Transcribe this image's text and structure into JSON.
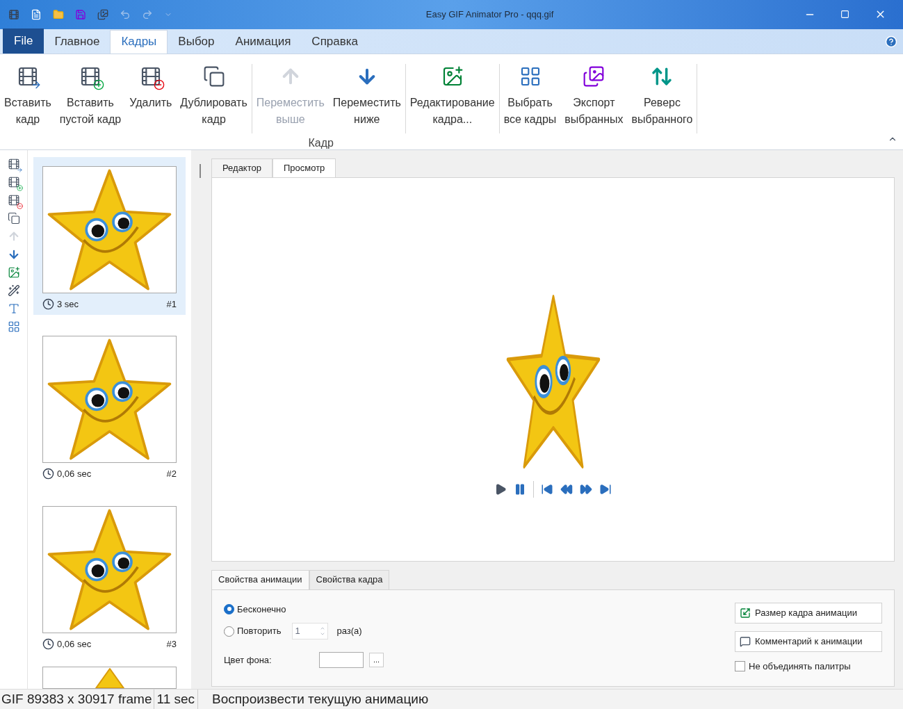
{
  "window": {
    "title": "Easy GIF Animator Pro - qqq.gif"
  },
  "quick_access": [
    {
      "kind": "film",
      "disabled": false
    },
    {
      "kind": "new",
      "disabled": false
    },
    {
      "kind": "open",
      "disabled": false
    },
    {
      "kind": "save",
      "disabled": false
    },
    {
      "kind": "export",
      "disabled": false
    },
    {
      "kind": "undo",
      "disabled": true
    },
    {
      "kind": "redo",
      "disabled": true
    },
    {
      "kind": "more",
      "disabled": true
    }
  ],
  "menu_tabs": [
    {
      "label": "File",
      "kind": "file",
      "selected": false
    },
    {
      "label": "Главное",
      "kind": "tab",
      "selected": false
    },
    {
      "label": "Кадры",
      "kind": "tab",
      "selected": true
    },
    {
      "label": "Выбор",
      "kind": "tab",
      "selected": false
    },
    {
      "label": "Анимация",
      "kind": "tab",
      "selected": false
    },
    {
      "label": "Справка",
      "kind": "tab",
      "selected": false
    }
  ],
  "ribbon": {
    "group_label": "Кадр",
    "sections": [
      [
        {
          "kind": "insert",
          "lines": [
            "Вставить",
            "кадр"
          ],
          "disabled": false
        },
        {
          "kind": "insert_blank",
          "lines": [
            "Вставить",
            "пустой кадр"
          ],
          "disabled": false
        },
        {
          "kind": "delete",
          "lines": [
            "Удалить"
          ],
          "disabled": false
        },
        {
          "kind": "duplicate",
          "lines": [
            "Дублировать",
            "кадр"
          ],
          "disabled": false
        }
      ],
      [
        {
          "kind": "up",
          "lines": [
            "Переместить",
            "выше"
          ],
          "disabled": true
        },
        {
          "kind": "down",
          "lines": [
            "Переместить",
            "ниже"
          ],
          "disabled": false
        }
      ],
      [
        {
          "kind": "edit",
          "lines": [
            "Редактирование",
            "кадра..."
          ],
          "disabled": false
        }
      ],
      [
        {
          "kind": "select_all",
          "lines": [
            "Выбрать",
            "все кадры"
          ],
          "disabled": false
        },
        {
          "kind": "export",
          "lines": [
            "Экспорт",
            "выбранных"
          ],
          "disabled": false
        },
        {
          "kind": "reverse",
          "lines": [
            "Реверс",
            "выбранного"
          ],
          "disabled": false
        }
      ]
    ]
  },
  "side_toolbar": [
    {
      "kind": "insert",
      "disabled": false
    },
    {
      "kind": "insert_blank",
      "disabled": false
    },
    {
      "kind": "delete",
      "disabled": false
    },
    {
      "kind": "duplicate",
      "disabled": false
    },
    {
      "kind": "up",
      "disabled": true
    },
    {
      "kind": "down",
      "disabled": false
    },
    {
      "kind": "edit",
      "disabled": false
    },
    {
      "kind": "wand",
      "disabled": false
    },
    {
      "kind": "text",
      "disabled": false
    },
    {
      "kind": "select_all",
      "disabled": false
    }
  ],
  "frames": [
    {
      "duration": "3 sec",
      "number": "#1",
      "selected": true
    },
    {
      "duration": "0,06 sec",
      "number": "#2",
      "selected": false
    },
    {
      "duration": "0,06 sec",
      "number": "#3",
      "selected": false
    }
  ],
  "editor_tabs": [
    {
      "label": "Редактор",
      "selected": false
    },
    {
      "label": "Просмотр",
      "selected": true
    }
  ],
  "player_controls": [
    {
      "kind": "play",
      "disabled": true
    },
    {
      "kind": "pause",
      "disabled": false
    },
    {
      "kind": "first",
      "disabled": false
    },
    {
      "kind": "prev",
      "disabled": false
    },
    {
      "kind": "next",
      "disabled": false
    },
    {
      "kind": "last",
      "disabled": false
    }
  ],
  "properties_tabs": [
    {
      "label": "Свойства анимации",
      "selected": true
    },
    {
      "label": "Свойства кадра",
      "selected": false
    }
  ],
  "loop_options": [
    {
      "label": "Бесконечно",
      "selected": true
    },
    {
      "label": "Повторить",
      "selected": false
    }
  ],
  "repeat_count": {
    "value": "1",
    "unit": "раз(а)"
  },
  "background_color": {
    "label": "Цвет фона:",
    "button": "..."
  },
  "side_buttons": [
    {
      "kind": "size",
      "label": "Размер кадра анимации"
    },
    {
      "kind": "comment",
      "label": "Комментарий к анимации"
    }
  ],
  "merge_palettes": {
    "label": "Не объединять палитры",
    "checked": false
  },
  "status_bar": [
    "GIF 89383 x 30917 frame",
    "11 sec",
    "Воспроизвести текущую анимацию"
  ]
}
